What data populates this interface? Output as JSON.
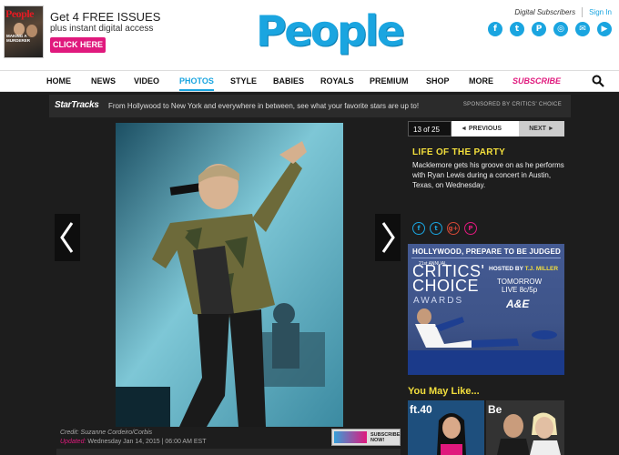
{
  "promo": {
    "mag_logo": "People",
    "mag_cover_text": "MAKING A MURDERER",
    "title": "Get 4 FREE ISSUES",
    "subtitle": "plus instant digital access",
    "cta": "CLICK HERE"
  },
  "brand": {
    "logo": "People"
  },
  "account": {
    "digital_subscribers": "Digital Subscribers",
    "sign_in": "Sign In"
  },
  "social": [
    {
      "icon": "facebook-icon",
      "glyph": "f"
    },
    {
      "icon": "twitter-icon",
      "glyph": "t"
    },
    {
      "icon": "pinterest-icon",
      "glyph": "P"
    },
    {
      "icon": "instagram-icon",
      "glyph": "◎"
    },
    {
      "icon": "email-icon",
      "glyph": "✉"
    },
    {
      "icon": "video-icon",
      "glyph": "▶"
    }
  ],
  "nav": {
    "items": [
      "HOME",
      "NEWS",
      "VIDEO",
      "PHOTOS",
      "STYLE",
      "BABIES",
      "ROYALS",
      "PREMIUM",
      "SHOP",
      "MORE",
      "SUBSCRIBE"
    ],
    "active": "PHOTOS"
  },
  "startracks": {
    "logo": "StarTracks",
    "tagline": "From Hollywood to New York and everywhere in between, see what your favorite stars are up to!",
    "sponsored": "SPONSORED BY CRITICS' CHOICE"
  },
  "gallery": {
    "counter": "13 of 25",
    "prev": "◄ PREVIOUS",
    "next": "NEXT ►",
    "caption_title": "LIFE OF THE PARTY",
    "caption_body": "Macklemore gets his groove on as he performs with Ryan Lewis during a concert in Austin, Texas, on Wednesday.",
    "credit": "Credit: Suzanne Cordeiro/Corbis",
    "updated_label": "Updated:",
    "updated_value": " Wednesday Jan 14, 2015 | 06:00 AM EST",
    "subscribe_ad": "SUBSCRIBE NOW!"
  },
  "ad": {
    "headline": "HOLLYWOOD, PREPARE TO BE JUDGED",
    "annual": "21st ANNUAL",
    "critics": "CRITICS'",
    "choice": "CHOICE",
    "awards": "AWARDS",
    "hosted_by": "HOSTED BY ",
    "host_name": "T.J. MILLER",
    "tomorrow": "TOMORROW",
    "time": "LIVE 8c/5p",
    "network": "A&E"
  },
  "you_may_like": {
    "title": "You May Like...",
    "thumb1": "ft.40",
    "thumb2": "Be"
  },
  "colors": {
    "accent": "#1aa5e0",
    "pink": "#e0197d",
    "yellow": "#f3df3c",
    "dark": "#1d1d1d"
  }
}
